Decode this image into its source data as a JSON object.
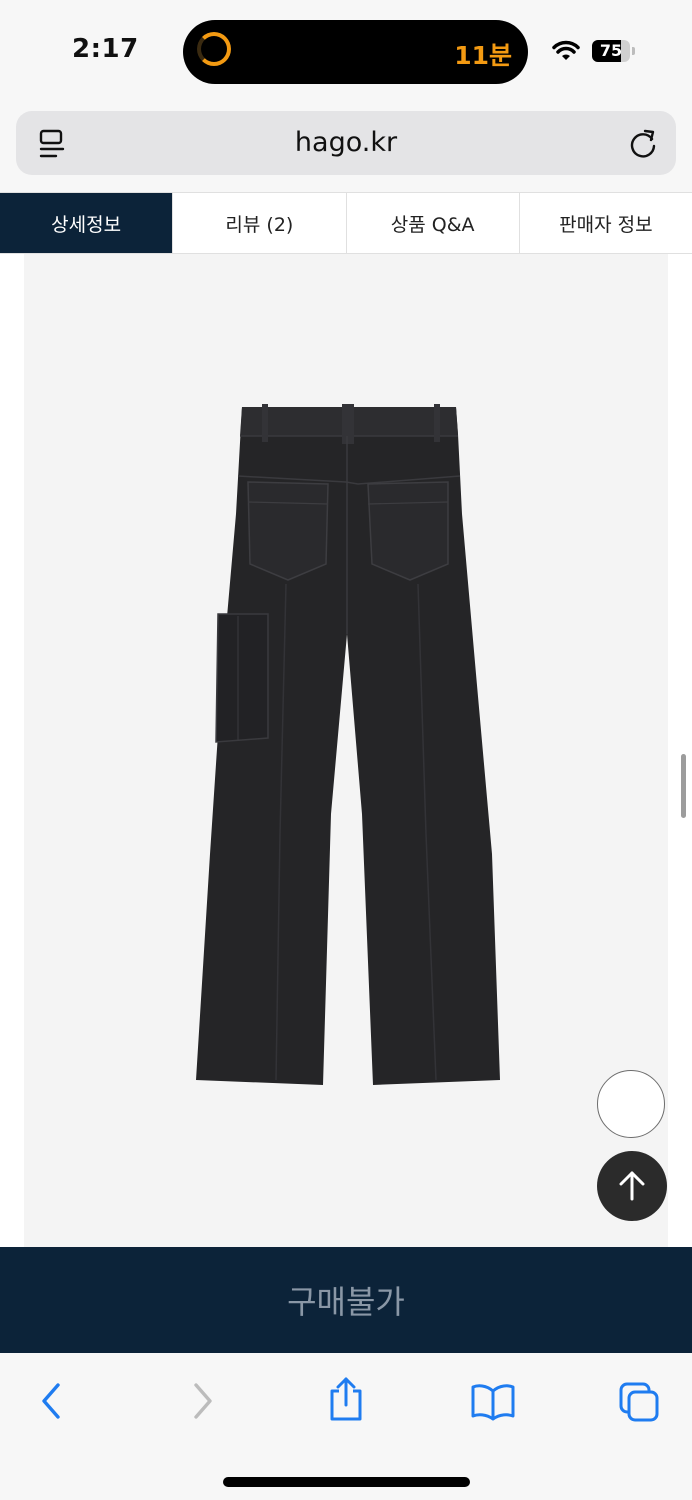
{
  "status_bar": {
    "time": "2:17",
    "timer": "11분",
    "battery": "75",
    "battery_level": 0.75
  },
  "browser": {
    "url": "hago.kr"
  },
  "tabs": [
    {
      "label": "상세정보",
      "active": true
    },
    {
      "label": "리뷰 (2)",
      "active": false
    },
    {
      "label": "상품 Q&A",
      "active": false
    },
    {
      "label": "판매자 정보",
      "active": false
    }
  ],
  "product": {
    "image": "black-cargo-jeans-back-view"
  },
  "buy_bar": {
    "label": "구매불가"
  },
  "colors": {
    "navy": "#0c2339",
    "accent_orange": "#f39a12",
    "ios_blue": "#1f7cf0"
  },
  "toolbar": {
    "icons": [
      "back-icon",
      "forward-icon",
      "share-icon",
      "bookmarks-icon",
      "tabs-icon"
    ]
  }
}
